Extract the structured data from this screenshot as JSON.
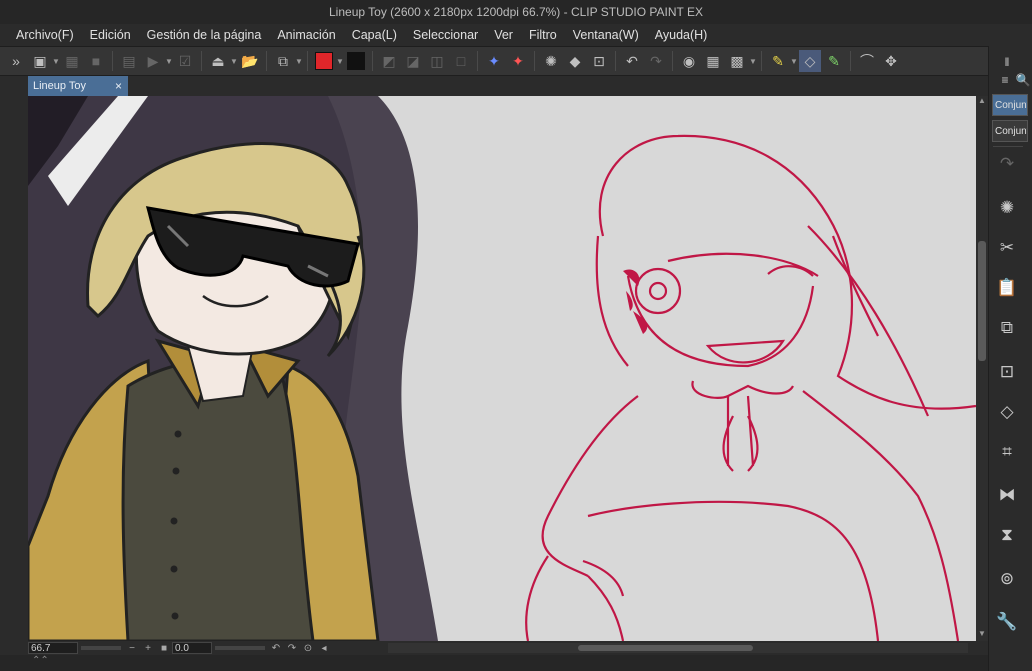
{
  "title": "Lineup Toy (2600 x 2180px 1200dpi 66.7%)  - CLIP STUDIO PAINT EX",
  "menu": [
    "Archivo(F)",
    "Edición",
    "Gestión de la página",
    "Animación",
    "Capa(L)",
    "Seleccionar",
    "Ver",
    "Filtro",
    "Ventana(W)",
    "Ayuda(H)"
  ],
  "tab": {
    "label": "Lineup Toy",
    "close": "×"
  },
  "colors": {
    "main": "#e0262a",
    "sub": "#111111",
    "accent": "#4a6e96"
  },
  "right_panel": {
    "btn1": "Conjunt",
    "btn2": "Conjunt"
  },
  "status": {
    "zoom": "66.7",
    "rotation": "0.0"
  },
  "icons": [
    "expand-left-icon",
    "new-file-icon",
    "layer-icon",
    "rect-icon",
    "film-icon",
    "play-icon",
    "check-icon",
    "ruler-icon",
    "folder-open-icon",
    "layer-settings-icon",
    "main-color-swatch",
    "sub-color-swatch",
    "transparent-icon",
    "magic-wand-icon",
    "loading-icon",
    "fill-icon",
    "crop-icon",
    "undo-icon",
    "redo-icon",
    "pen-icon",
    "eraser-icon",
    "lasso-icon",
    "move-icon"
  ]
}
